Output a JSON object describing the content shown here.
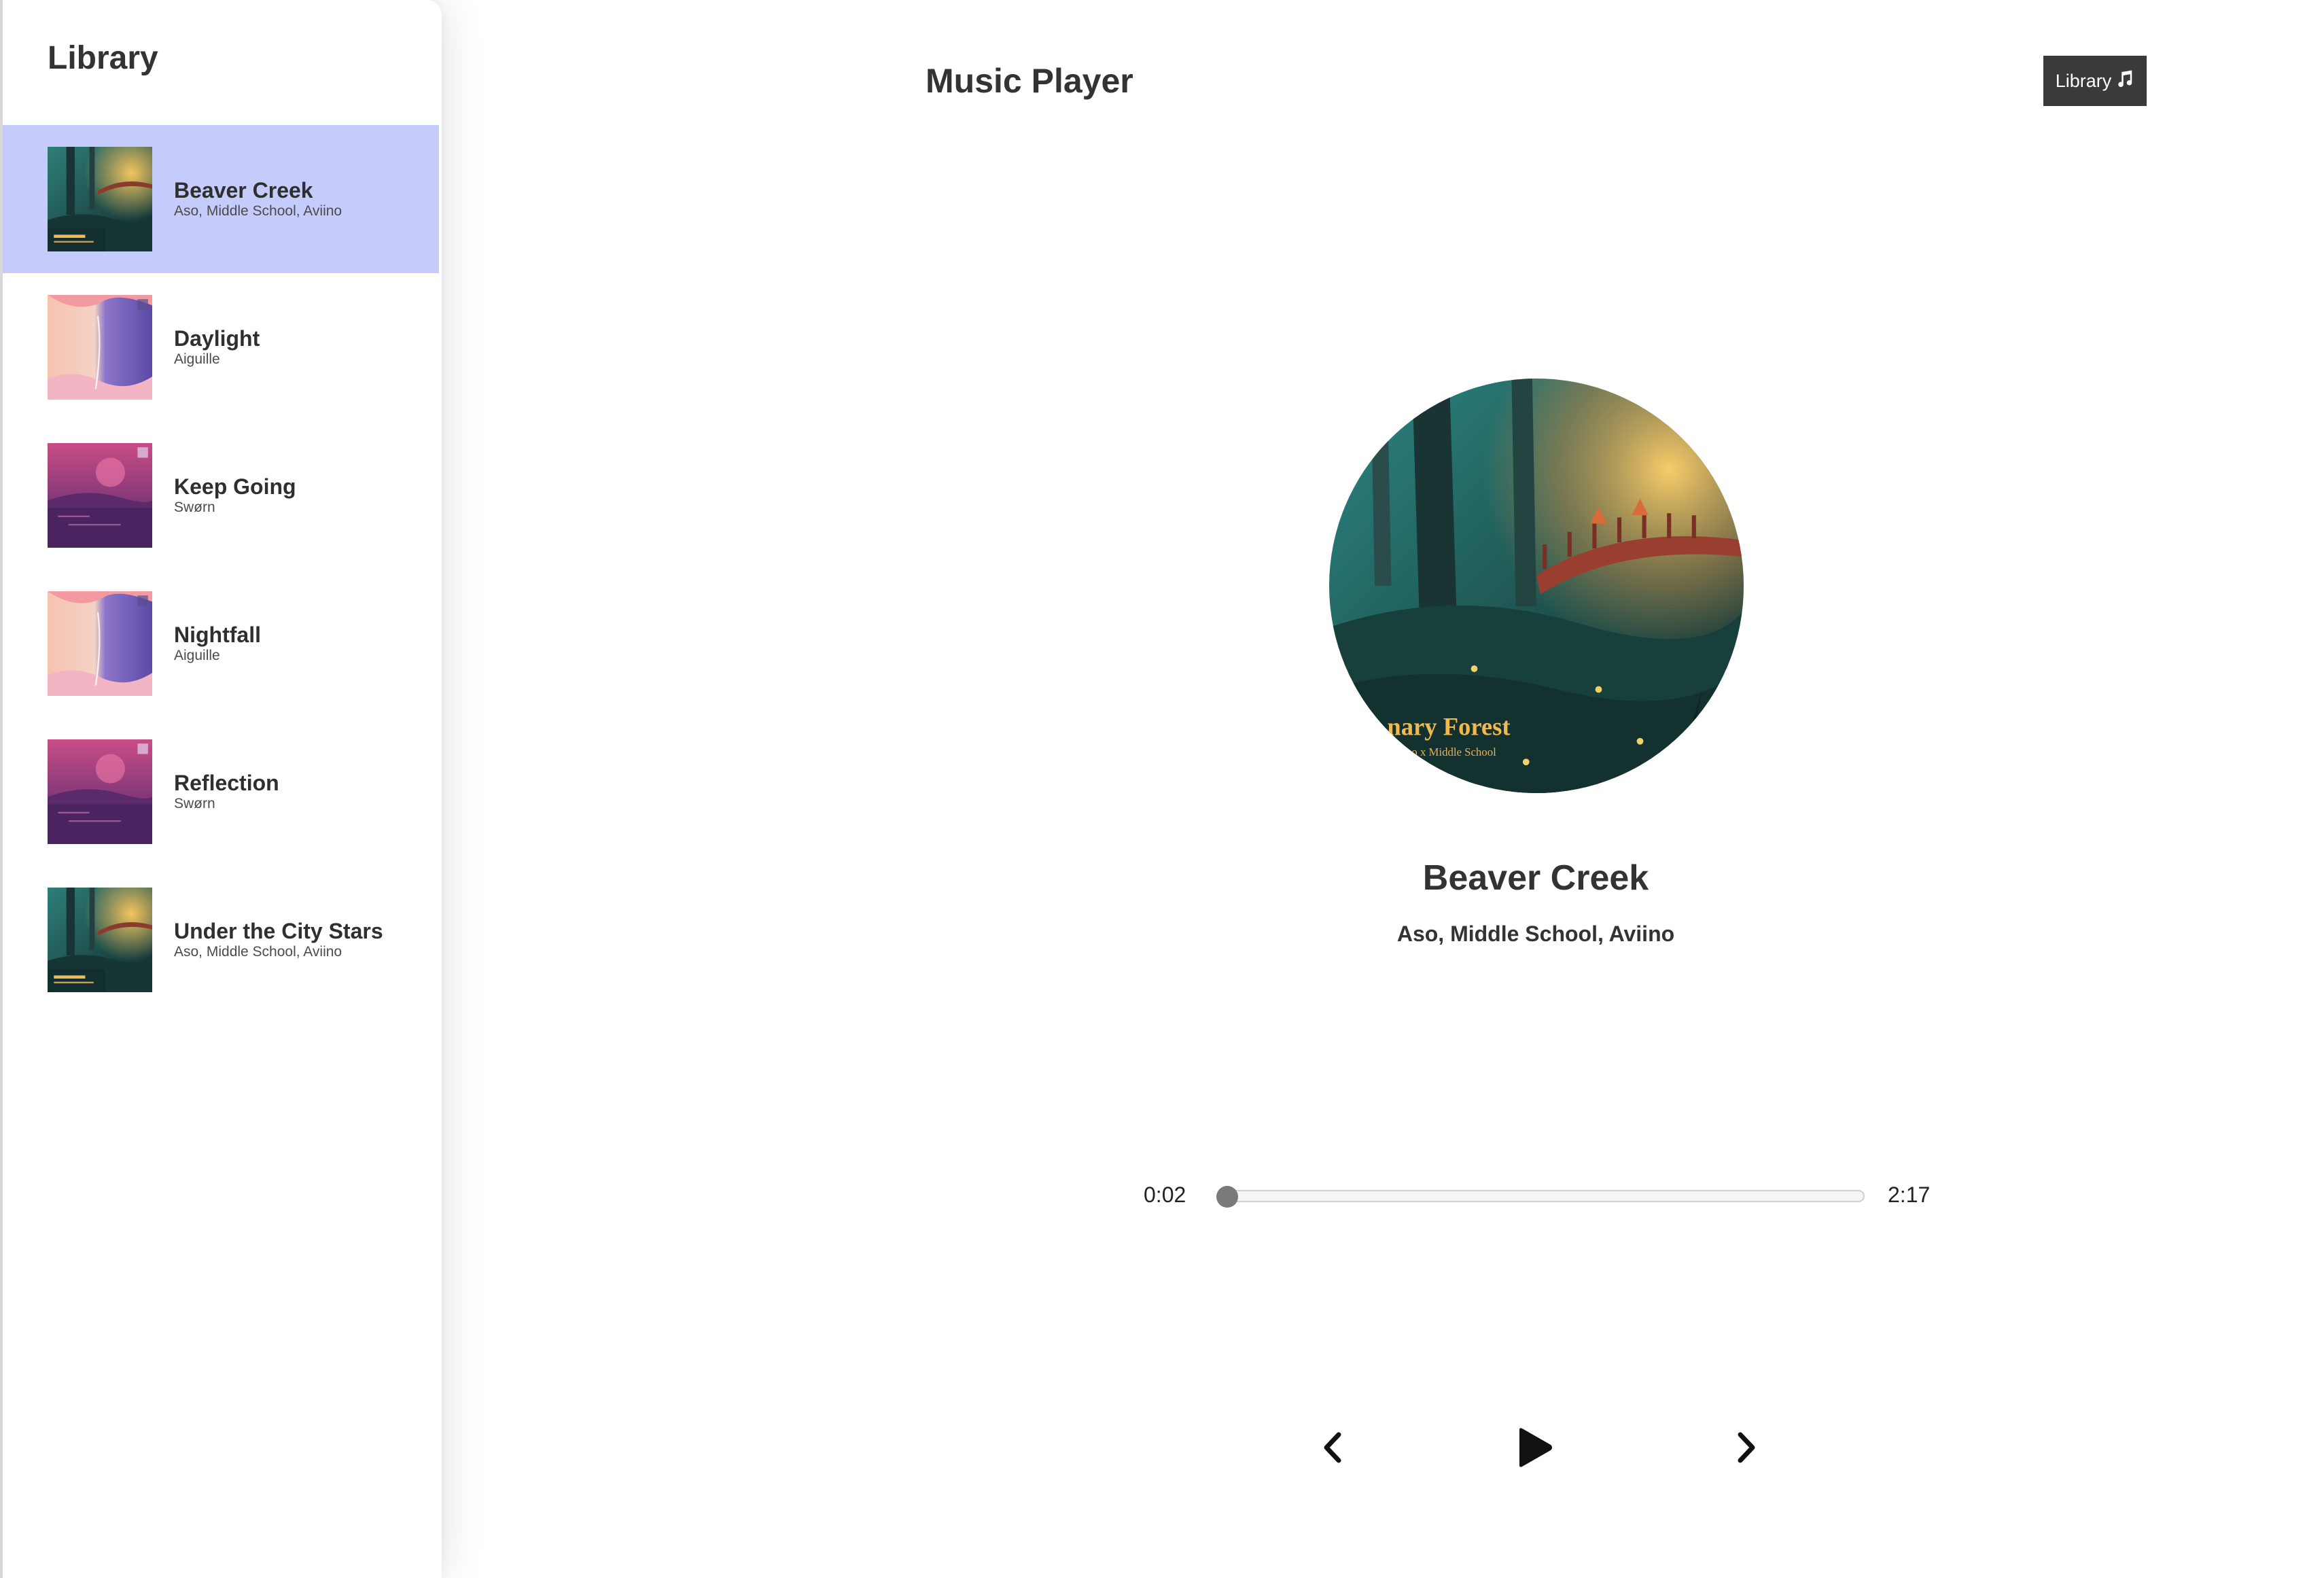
{
  "sidebar": {
    "title": "Library",
    "items": [
      {
        "title": "Beaver Creek",
        "artist": "Aso, Middle School, Aviino",
        "cover": "canary-forest-cover-icon",
        "active": true
      },
      {
        "title": "Daylight",
        "artist": "Aiguille",
        "cover": "daylight-cover-icon",
        "active": false
      },
      {
        "title": "Keep Going",
        "artist": "Swørn",
        "cover": "purple-lake-cover-icon",
        "active": false
      },
      {
        "title": "Nightfall",
        "artist": "Aiguille",
        "cover": "daylight-cover-icon",
        "active": false
      },
      {
        "title": "Reflection",
        "artist": "Swørn",
        "cover": "purple-lake-cover-icon",
        "active": false
      },
      {
        "title": "Under the City Stars",
        "artist": "Aso, Middle School, Aviino",
        "cover": "canary-forest-cover-icon",
        "active": false
      }
    ]
  },
  "header": {
    "title": "Music Player",
    "library_button": "Library",
    "library_icon": "music-note-icon"
  },
  "player": {
    "title": "Beaver Creek",
    "artist": "Aso, Middle School, Aviino",
    "artwork_icon": "canary-forest-artwork-icon",
    "current_time": "0:02",
    "total_time": "2:17",
    "progress_fraction": 0.015,
    "controls": {
      "prev_icon": "chevron-left-icon",
      "play_icon": "play-icon",
      "next_icon": "chevron-right-icon"
    }
  },
  "colors": {
    "active_row": "#c5ccfc",
    "button_bg": "#3a3a3a",
    "text": "#333333"
  }
}
